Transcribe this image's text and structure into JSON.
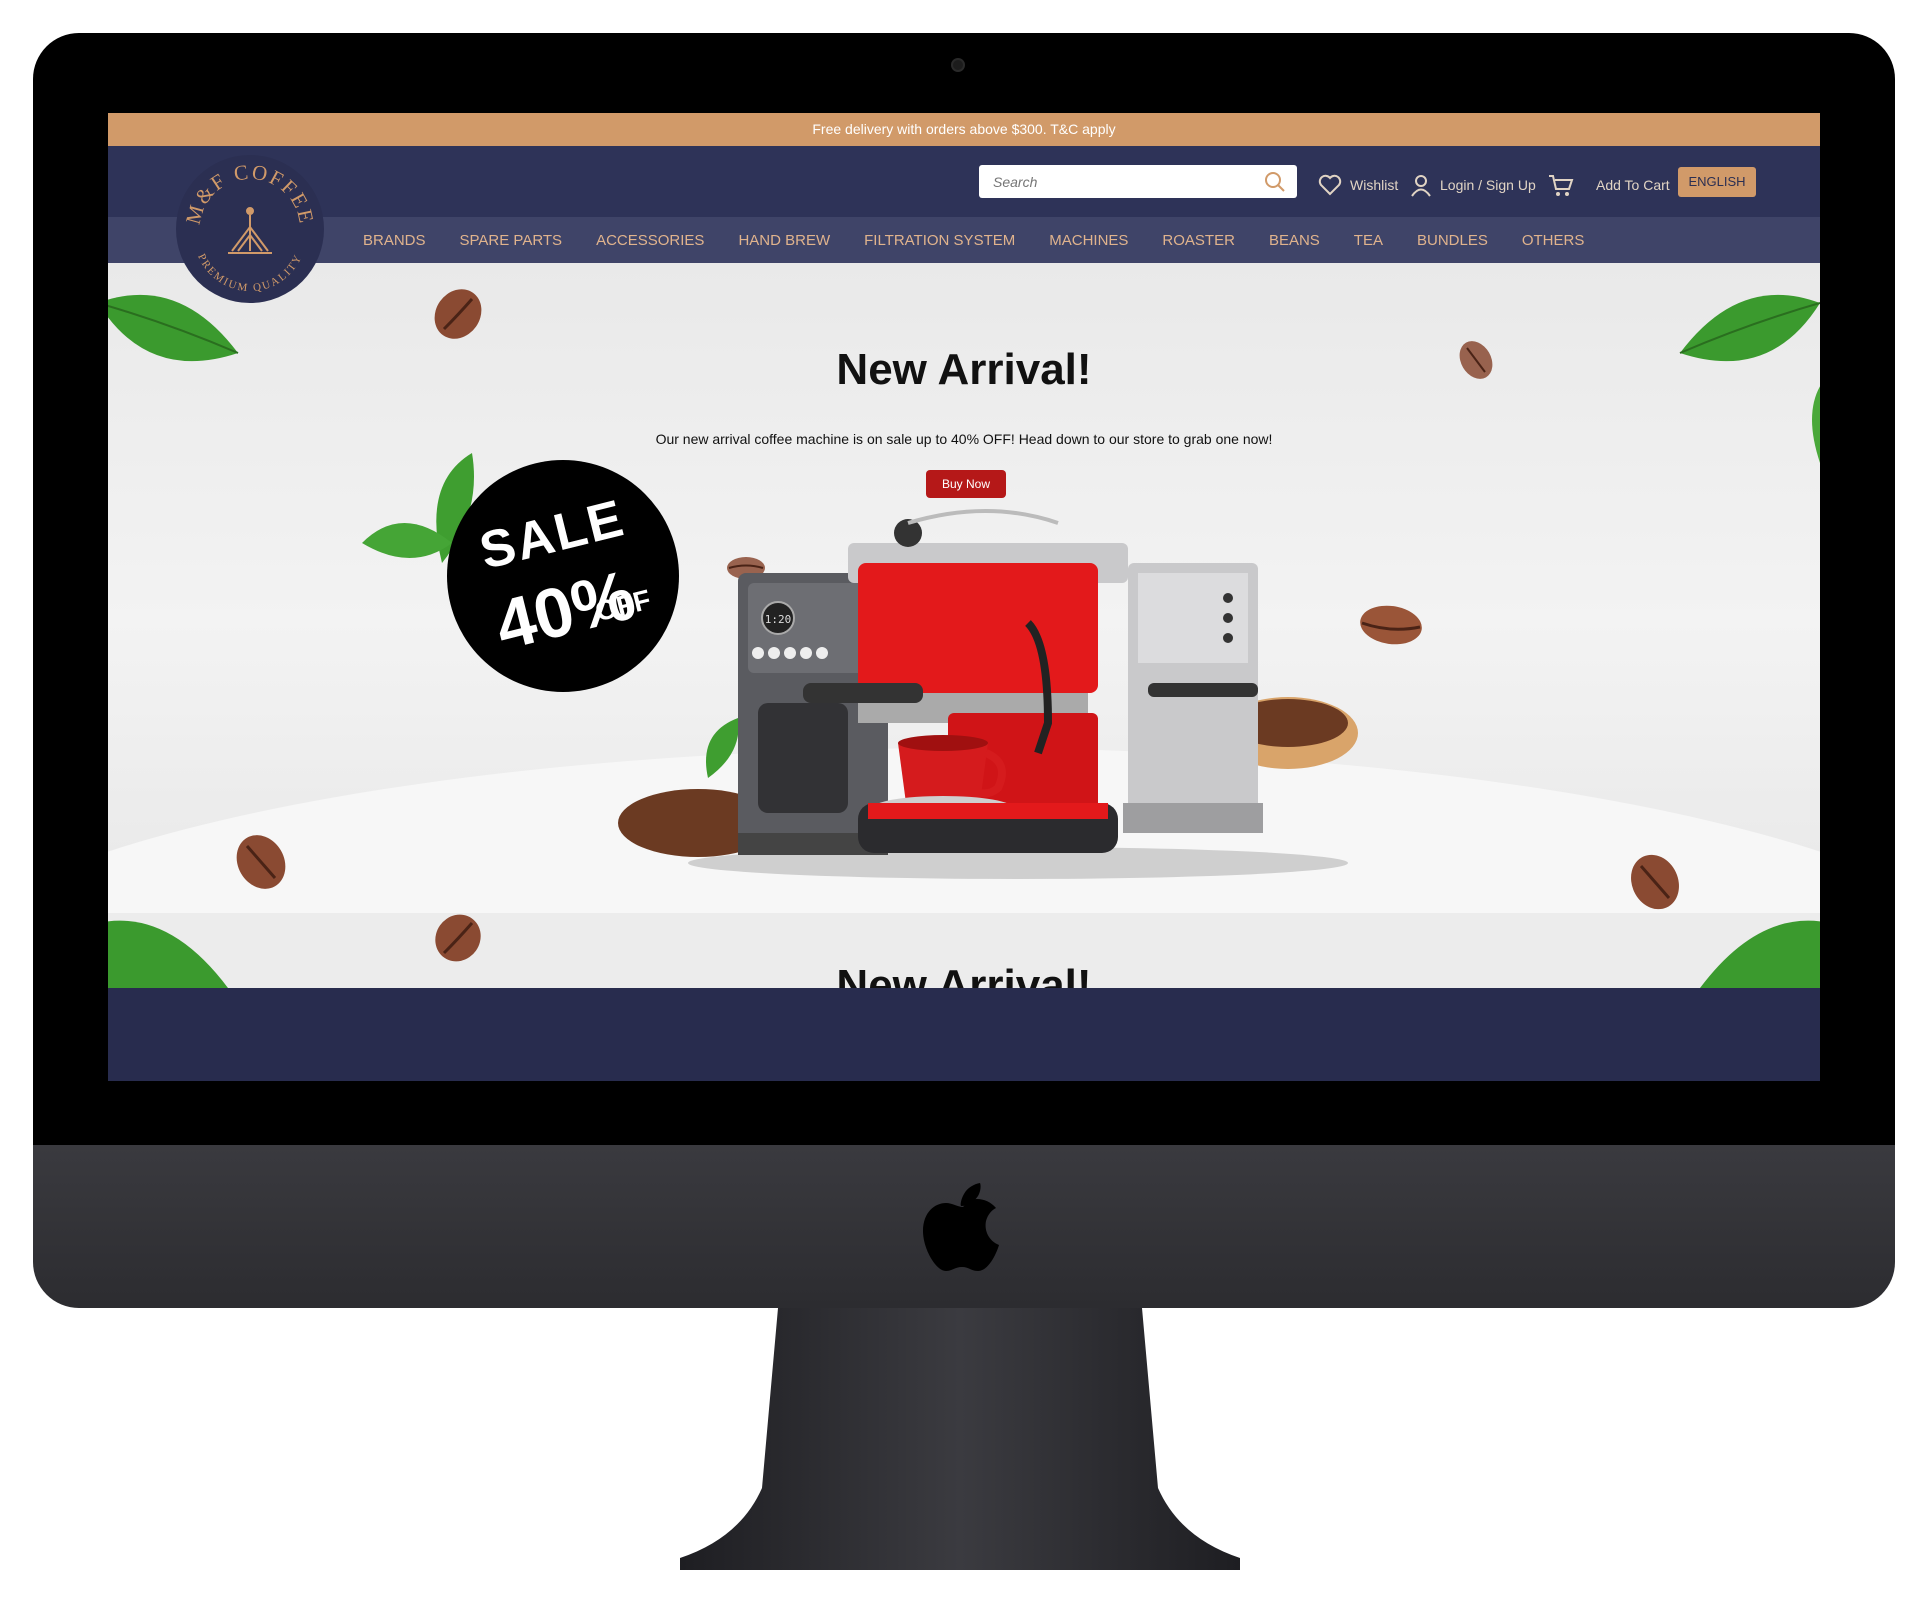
{
  "promo_bar": {
    "text": "Free delivery with orders above $300. T&C apply"
  },
  "logo": {
    "brand": "M&F COFFEE",
    "tagline": "PREMIUM QUALITY"
  },
  "search": {
    "placeholder": "Search"
  },
  "header_links": {
    "wishlist": "Wishlist",
    "login": "Login / Sign Up",
    "cart": "Add To Cart",
    "language": "ENGLISH"
  },
  "nav": {
    "items": [
      "BRANDS",
      "SPARE PARTS",
      "ACCESSORIES",
      "HAND BREW",
      "FILTRATION SYSTEM",
      "MACHINES",
      "ROASTER",
      "BEANS",
      "TEA",
      "BUNDLES",
      "OTHERS"
    ]
  },
  "hero": {
    "title": "New Arrival!",
    "subtitle": "Our new arrival coffee machine is on sale up to 40% OFF! Head down to our store to grab one now!",
    "button": "Buy Now",
    "sale_badge": {
      "word": "SALE",
      "percent": "40%",
      "off": "OFF"
    },
    "display_readout": "1:20"
  },
  "next_slide": {
    "title": "New Arrival!"
  },
  "colors": {
    "promo": "#d19a69",
    "header": "#2e3358",
    "nav": "#3f4468",
    "nav_text": "#e0b38d",
    "button": "#b51818"
  },
  "icons": [
    "search-icon",
    "heart-icon",
    "user-icon",
    "cart-icon",
    "apple-logo-icon"
  ]
}
